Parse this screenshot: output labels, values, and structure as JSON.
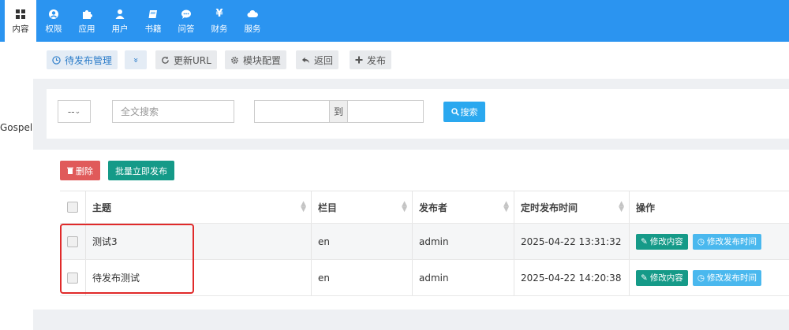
{
  "topnav": {
    "items": [
      {
        "label": "内容",
        "icon": "grid-icon",
        "active": true
      },
      {
        "label": "权限",
        "icon": "user-circle-icon"
      },
      {
        "label": "应用",
        "icon": "puzzle-icon"
      },
      {
        "label": "用户",
        "icon": "user-icon"
      },
      {
        "label": "书籍",
        "icon": "book-icon"
      },
      {
        "label": "问答",
        "icon": "chat-icon"
      },
      {
        "label": "财务",
        "icon": "yen-icon"
      },
      {
        "label": "服务",
        "icon": "cloud-icon"
      }
    ]
  },
  "sidebar": {
    "text": "Gospel"
  },
  "toolbar": {
    "pending": "待发布管理",
    "dropdown": "»",
    "update_url": "更新URL",
    "module_config": "模块配置",
    "back": "返回",
    "publish": "发布"
  },
  "search": {
    "select_value": "-- ",
    "fulltext_placeholder": "全文搜索",
    "to_label": "到",
    "search_button": "搜索"
  },
  "actions": {
    "delete": "删除",
    "batch_publish": "批量立即发布"
  },
  "table": {
    "headers": {
      "title": "主题",
      "column": "栏目",
      "publisher": "发布者",
      "scheduled_time": "定时发布时间",
      "operations": "操作"
    },
    "rows": [
      {
        "title": "测试3",
        "column": "en",
        "publisher": "admin",
        "scheduled_time": "2025-04-22 13:31:32",
        "edit": "修改内容",
        "edit_time": "修改发布时间"
      },
      {
        "title": "待发布测试",
        "column": "en",
        "publisher": "admin",
        "scheduled_time": "2025-04-22 14:20:38",
        "edit": "修改内容",
        "edit_time": "修改发布时间"
      }
    ]
  },
  "colors": {
    "topbar": "#2b94f0",
    "highlight": "#e02a2a"
  }
}
